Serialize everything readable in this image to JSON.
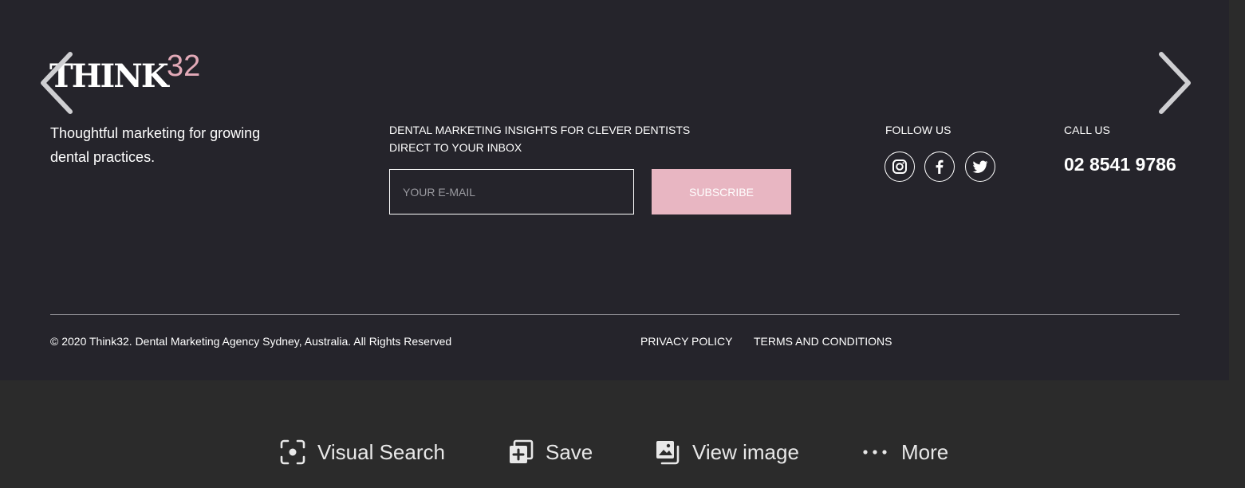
{
  "brand": {
    "word": "THINK",
    "number": "32",
    "accent_color": "#e3aab8"
  },
  "tagline": {
    "line1": "Thoughtful marketing for growing",
    "line2": "dental practices."
  },
  "newsletter": {
    "heading_line1": "DENTAL MARKETING INSIGHTS FOR CLEVER DENTISTS",
    "heading_line2": "DIRECT TO YOUR INBOX",
    "email_placeholder": "YOUR E-MAIL",
    "subscribe_label": "SUBSCRIBE",
    "button_color": "#e8b6c2"
  },
  "follow": {
    "heading": "FOLLOW US",
    "icons": [
      "instagram-icon",
      "facebook-icon",
      "twitter-icon"
    ]
  },
  "contact": {
    "heading": "CALL US",
    "phone": "02 8541 9786"
  },
  "legal": {
    "copyright": "© 2020 Think32. Dental Marketing Agency Sydney, Australia. All Rights Reserved",
    "privacy": "PRIVACY POLICY",
    "terms": "TERMS AND CONDITIONS"
  },
  "viewer": {
    "prev_icon": "chevron-left-icon",
    "next_icon": "chevron-right-icon",
    "actions": [
      {
        "label": "Visual Search",
        "icon": "visual-search-icon"
      },
      {
        "label": "Save",
        "icon": "save-icon"
      },
      {
        "label": "View image",
        "icon": "view-image-icon"
      },
      {
        "label": "More",
        "icon": "more-icon"
      }
    ]
  },
  "colors": {
    "footer_bg": "#25242b",
    "viewer_bg": "#2b2b2b"
  }
}
